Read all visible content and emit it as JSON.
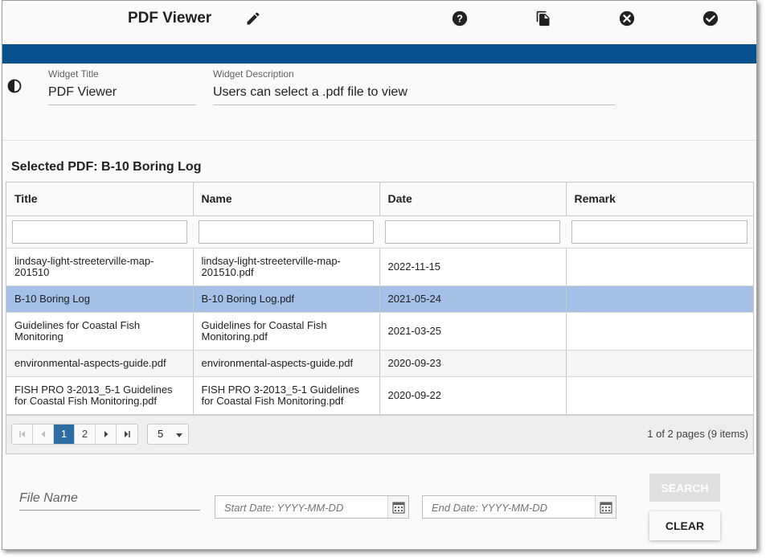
{
  "header": {
    "title": "PDF Viewer",
    "icons": [
      "edit-icon",
      "help-icon",
      "copy-icon",
      "close-icon",
      "confirm-icon"
    ],
    "band_color": "#08518f"
  },
  "widget": {
    "title_label": "Widget Title",
    "title_value": "PDF Viewer",
    "description_label": "Widget Description",
    "description_value": "Users can select a .pdf file to view"
  },
  "selection": {
    "label": "Selected PDF: B-10 Boring Log"
  },
  "table": {
    "columns": [
      "Title",
      "Name",
      "Date",
      "Remark"
    ],
    "rows": [
      {
        "title": "lindsay-light-streeterville-map-201510",
        "name": "lindsay-light-streeterville-map-201510.pdf",
        "date": "2022-11-15",
        "remark": ""
      },
      {
        "title": "B-10 Boring Log",
        "name": "B-10 Boring Log.pdf",
        "date": "2021-05-24",
        "remark": ""
      },
      {
        "title": "Guidelines for Coastal Fish Monitoring",
        "name": "Guidelines for Coastal Fish Monitoring.pdf",
        "date": "2021-03-25",
        "remark": ""
      },
      {
        "title": "environmental-aspects-guide.pdf",
        "name": "environmental-aspects-guide.pdf",
        "date": "2020-09-23",
        "remark": ""
      },
      {
        "title": "FISH PRO 3-2013_5-1 Guidelines for Coastal Fish Monitoring.pdf",
        "name": "FISH PRO 3-2013_5-1 Guidelines for Coastal Fish Monitoring.pdf",
        "date": "2020-09-22",
        "remark": ""
      }
    ],
    "selected_color": "#a4c0e6"
  },
  "pager": {
    "pages": [
      "1",
      "2"
    ],
    "current_page": "1",
    "page_size": "5",
    "info": "1 of 2 pages (9 items)",
    "accent_color": "#2e6da4"
  },
  "search": {
    "file_name_placeholder": "File Name",
    "start_date_placeholder": "Start Date: YYYY-MM-DD",
    "end_date_placeholder": "End Date: YYYY-MM-DD",
    "search_label": "SEARCH",
    "clear_label": "CLEAR"
  }
}
